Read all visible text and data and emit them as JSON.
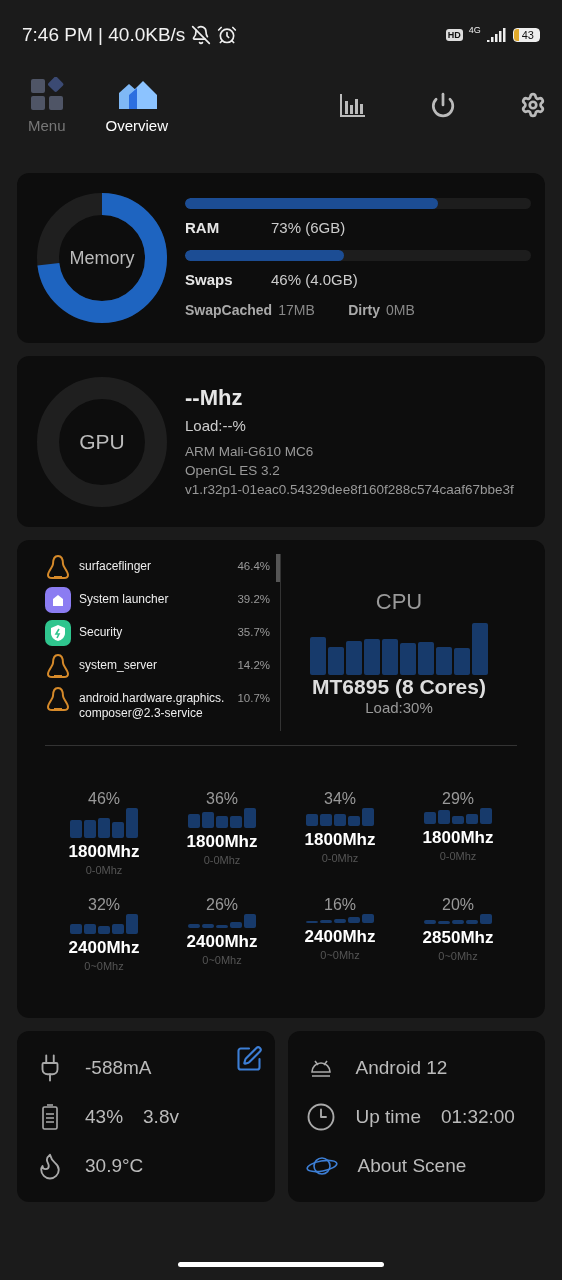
{
  "status_bar": {
    "time_speed": "7:46 PM | 40.0KB/s",
    "hd": "HD",
    "network": "4G",
    "battery": "43"
  },
  "tabs": [
    {
      "label": "Menu",
      "kind": "menu",
      "selected": false
    },
    {
      "label": "Overview",
      "kind": "overview",
      "selected": true
    }
  ],
  "memory": {
    "title": "Memory",
    "ram": {
      "label": "RAM",
      "value": "73% (6GB)",
      "level": 0.73
    },
    "swaps": {
      "label": "Swaps",
      "value": "46% (4.0GB)",
      "level": 0.46
    },
    "swap_cached": {
      "label": "SwapCached",
      "value": "17MB"
    },
    "dirty": {
      "label": "Dirty",
      "value": "0MB"
    }
  },
  "gpu": {
    "title": "GPU",
    "freq": "--Mhz",
    "load": "Load:--%",
    "lines": [
      "ARM Mali-G610 MC6",
      "OpenGL ES 3.2",
      "v1.r32p1-01eac0.54329dee8f160f288c574caaf67bbe3f"
    ]
  },
  "processes": [
    {
      "name": "surfaceflinger",
      "kind": "linux",
      "percent": "46.4%"
    },
    {
      "name": "System launcher",
      "kind": "launcher",
      "percent": "39.2%"
    },
    {
      "name": "Security",
      "kind": "security",
      "percent": "35.7%"
    },
    {
      "name": "system_server",
      "kind": "linux",
      "percent": "14.2%"
    },
    {
      "name": "android.hardware.graphics.composer@2.3-service",
      "kind": "linux",
      "percent": "10.7%"
    }
  ],
  "cpu": {
    "title": "CPU",
    "model": "MT6895 (8 Cores)",
    "load": "Load:30%"
  },
  "cores": [
    {
      "percent": "46%",
      "freq": "1800Mhz",
      "range": "0-0Mhz"
    },
    {
      "percent": "36%",
      "freq": "1800Mhz",
      "range": "0-0Mhz"
    },
    {
      "percent": "34%",
      "freq": "1800Mhz",
      "range": "0-0Mhz"
    },
    {
      "percent": "29%",
      "freq": "1800Mhz",
      "range": "0-0Mhz"
    },
    {
      "percent": "32%",
      "freq": "2400Mhz",
      "range": "0~0Mhz"
    },
    {
      "percent": "26%",
      "freq": "2400Mhz",
      "range": "0~0Mhz"
    },
    {
      "percent": "16%",
      "freq": "2400Mhz",
      "range": "0~0Mhz"
    },
    {
      "percent": "20%",
      "freq": "2850Mhz",
      "range": "0~0Mhz"
    }
  ],
  "power": [
    {
      "kind": "current",
      "texts": [
        "-588mA"
      ]
    },
    {
      "kind": "battery",
      "texts": [
        "43%",
        "3.8v"
      ]
    },
    {
      "kind": "temperature",
      "texts": [
        "30.9°C"
      ]
    }
  ],
  "system": [
    {
      "kind": "android",
      "texts": [
        "Android 12"
      ]
    },
    {
      "kind": "uptime",
      "texts": [
        "Up time",
        "01:32:00"
      ]
    },
    {
      "kind": "about",
      "texts": [
        "About Scene"
      ]
    }
  ]
}
